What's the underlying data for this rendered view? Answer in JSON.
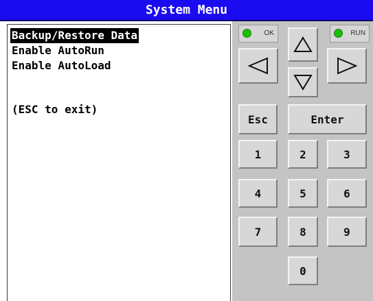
{
  "title": "System Menu",
  "menu": {
    "items": [
      {
        "label": "Backup/Restore Data",
        "selected": true
      },
      {
        "label": "Enable AutoRun",
        "selected": false
      },
      {
        "label": "Enable AutoLoad",
        "selected": false
      }
    ],
    "hint": "(ESC to exit)"
  },
  "indicators": {
    "ok_label": "OK",
    "run_label": "RUN",
    "led_color": "#13c400"
  },
  "keypad": {
    "esc": "Esc",
    "enter": "Enter",
    "digits": [
      "1",
      "2",
      "3",
      "4",
      "5",
      "6",
      "7",
      "8",
      "9",
      "0"
    ],
    "arrow_icons": [
      "up-arrow-icon",
      "left-arrow-icon",
      "down-arrow-icon",
      "right-arrow-icon"
    ]
  },
  "colors": {
    "titlebar": "#1b0bf0",
    "panel": "#c4c4c4",
    "selection": "#000000"
  }
}
